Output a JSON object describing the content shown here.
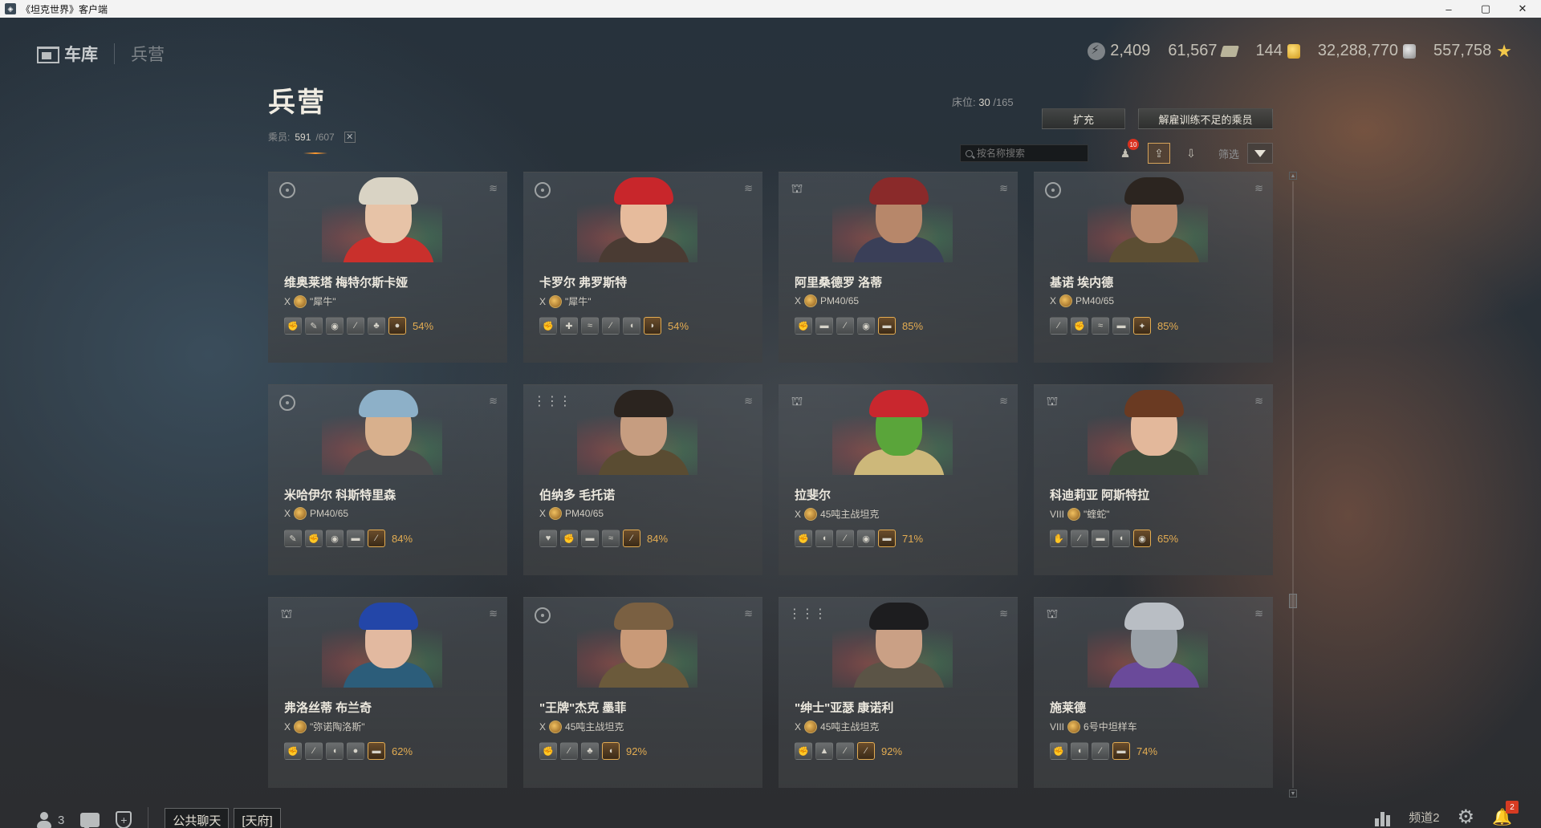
{
  "window": {
    "title": "《坦克世界》客户端",
    "controls": [
      "–",
      "▢",
      "✕"
    ]
  },
  "topnav": {
    "garage": "车库",
    "barracks": "兵营"
  },
  "currencies": {
    "free_xp": "2,409",
    "bonds": "61,567",
    "gold": "144",
    "credits": "32,288,770",
    "premium_xp": "557,758"
  },
  "page": {
    "title": "兵营",
    "crew_label": "乘员:",
    "crew_current": "591",
    "crew_total": "/607",
    "close": "✕",
    "berths_label": "床位:",
    "berths_value": "30",
    "berths_total": "/165",
    "btn_expand": "扩充",
    "btn_dismiss": "解雇训练不足的乘员",
    "search_placeholder": "按名称搜索",
    "filter_label": "筛选",
    "filter_badge": "10"
  },
  "cards": [
    {
      "name": "维奥莱塔 梅特尔斯卡娅",
      "tier": "X",
      "tank": "\"犀牛\"",
      "role": "gunner",
      "pct": "54%",
      "skills": [
        "✊",
        "✎",
        "◉",
        "⁄",
        "♣",
        "●"
      ],
      "hat": "#d9d3c4",
      "skin": "#e7c3a7",
      "body": "#c9302c"
    },
    {
      "name": "卡罗尔 弗罗斯特",
      "tier": "X",
      "tank": "\"犀牛\"",
      "role": "gunner",
      "pct": "54%",
      "skills": [
        "✊",
        "✚",
        "≈",
        "⁄",
        "◖",
        "◗"
      ],
      "hat": "#c8262b",
      "skin": "#e6bb9c",
      "body": "#4a3b33"
    },
    {
      "name": "阿里桑德罗 洛蒂",
      "tier": "X",
      "tank": "PM40/65",
      "role": "commander",
      "pct": "85%",
      "skills": [
        "✊",
        "▬",
        "⁄",
        "◉",
        "▬"
      ],
      "hat": "#8a2a2a",
      "skin": "#b7876a",
      "body": "#3a3f58"
    },
    {
      "name": "基诺 埃内德",
      "tier": "X",
      "tank": "PM40/65",
      "role": "gunner",
      "pct": "85%",
      "skills": [
        "⁄",
        "✊",
        "≈",
        "▬",
        "✦"
      ],
      "hat": "#2c2520",
      "skin": "#b98a6d",
      "body": "#5c4e33"
    },
    {
      "name": "米哈伊尔 科斯特里森",
      "tier": "X",
      "tank": "PM40/65",
      "role": "gunner",
      "pct": "84%",
      "skills": [
        "✎",
        "✊",
        "◉",
        "▬",
        "⁄"
      ],
      "hat": "#8db0c8",
      "skin": "#d8b08d",
      "body": "#4b4b4d"
    },
    {
      "name": "伯纳多 毛托诺",
      "tier": "X",
      "tank": "PM40/65",
      "role": "loader",
      "pct": "84%",
      "skills": [
        "♥",
        "✊",
        "▬",
        "≈",
        "⁄"
      ],
      "hat": "#2b241f",
      "skin": "#c69d80",
      "body": "#5a4c32"
    },
    {
      "name": "拉斐尔",
      "tier": "X",
      "tank": "45吨主战坦克",
      "role": "commander",
      "pct": "71%",
      "skills": [
        "✊",
        "◖",
        "⁄",
        "◉",
        "▬"
      ],
      "hat": "#c9272e",
      "skin": "#5aa53a",
      "body": "#cdb87a"
    },
    {
      "name": "科迪莉亚 阿斯特拉",
      "tier": "VIII",
      "tank": "\"蝰蛇\"",
      "role": "commander",
      "pct": "65%",
      "skills": [
        "✋",
        "⁄",
        "▬",
        "◖",
        "◉"
      ],
      "hat": "#6a3a22",
      "skin": "#e3b89b",
      "body": "#3c4a3a"
    },
    {
      "name": "弗洛丝蒂 布兰奇",
      "tier": "X",
      "tank": "\"弥诺陶洛斯\"",
      "role": "commander",
      "pct": "62%",
      "skills": [
        "✊",
        "⁄",
        "◖",
        "●",
        "▬"
      ],
      "hat": "#2346a8",
      "skin": "#e2b9a0",
      "body": "#2c5d7a"
    },
    {
      "name": "\"王牌\"杰克 墨菲",
      "tier": "X",
      "tank": "45吨主战坦克",
      "role": "gunner",
      "pct": "92%",
      "skills": [
        "✊",
        "⁄",
        "♣",
        "◖"
      ],
      "hat": "#7a6042",
      "skin": "#c99a78",
      "body": "#6b5a3b"
    },
    {
      "name": "\"绅士\"亚瑟 康诺利",
      "tier": "X",
      "tank": "45吨主战坦克",
      "role": "loader",
      "pct": "92%",
      "skills": [
        "✊",
        "▲",
        "⁄",
        "⁄"
      ],
      "hat": "#1d1d1f",
      "skin": "#caa085",
      "body": "#5b5446"
    },
    {
      "name": "施莱德",
      "tier": "VIII",
      "tank": "6号中坦样车",
      "role": "commander",
      "pct": "74%",
      "skills": [
        "✊",
        "◖",
        "⁄",
        "▬"
      ],
      "hat": "#b9bec4",
      "skin": "#9aa1a8",
      "body": "#6a4a9a"
    }
  ],
  "bottom": {
    "friends_count": "3",
    "chat_public": "公共聊天",
    "chat_clan": "[天府]",
    "channel": "频道2",
    "notifications": "2"
  }
}
